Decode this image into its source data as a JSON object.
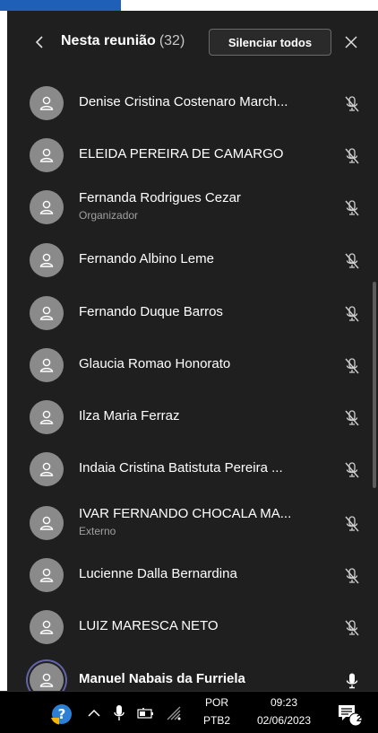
{
  "panel": {
    "title": "Nesta reunião",
    "count": "(32)",
    "mute_all_label": "Silenciar todos"
  },
  "participants": [
    {
      "name": "Denise Cristina Costenaro March...",
      "subtitle": "",
      "mic": "muted"
    },
    {
      "name": "ELEIDA PEREIRA DE CAMARGO",
      "subtitle": "",
      "mic": "muted"
    },
    {
      "name": "Fernanda Rodrigues Cezar",
      "subtitle": "Organizador",
      "mic": "muted"
    },
    {
      "name": "Fernando Albino Leme",
      "subtitle": "",
      "mic": "muted"
    },
    {
      "name": "Fernando Duque Barros",
      "subtitle": "",
      "mic": "muted"
    },
    {
      "name": "Glaucia Romao Honorato",
      "subtitle": "",
      "mic": "muted"
    },
    {
      "name": "Ilza Maria Ferraz",
      "subtitle": "",
      "mic": "muted"
    },
    {
      "name": "Indaia Cristina Batistuta Pereira ...",
      "subtitle": "",
      "mic": "muted"
    },
    {
      "name": "IVAR FERNANDO CHOCALA MA...",
      "subtitle": "Externo",
      "mic": "muted"
    },
    {
      "name": "Lucienne Dalla Bernardina",
      "subtitle": "",
      "mic": "muted"
    },
    {
      "name": "LUIZ MARESCA NETO",
      "subtitle": "",
      "mic": "muted"
    },
    {
      "name": "Manuel Nabais da Furriela",
      "subtitle": "",
      "mic": "on",
      "speaking": true
    }
  ],
  "taskbar": {
    "language": "POR",
    "keyboard": "PTB2",
    "time": "09:23",
    "date": "02/06/2023",
    "notification_count": "2",
    "icons": [
      "help-icon",
      "chevron-up-icon",
      "microphone-icon",
      "battery-icon",
      "wifi-icon",
      "notification-icon"
    ]
  },
  "colors": {
    "panel_bg": "#1f1f1f",
    "avatar_bg": "#8a8a8a",
    "speaking_ring": "#6264a7",
    "taskbar_bg": "#000000",
    "topbar_blue": "#1f5fb8"
  }
}
